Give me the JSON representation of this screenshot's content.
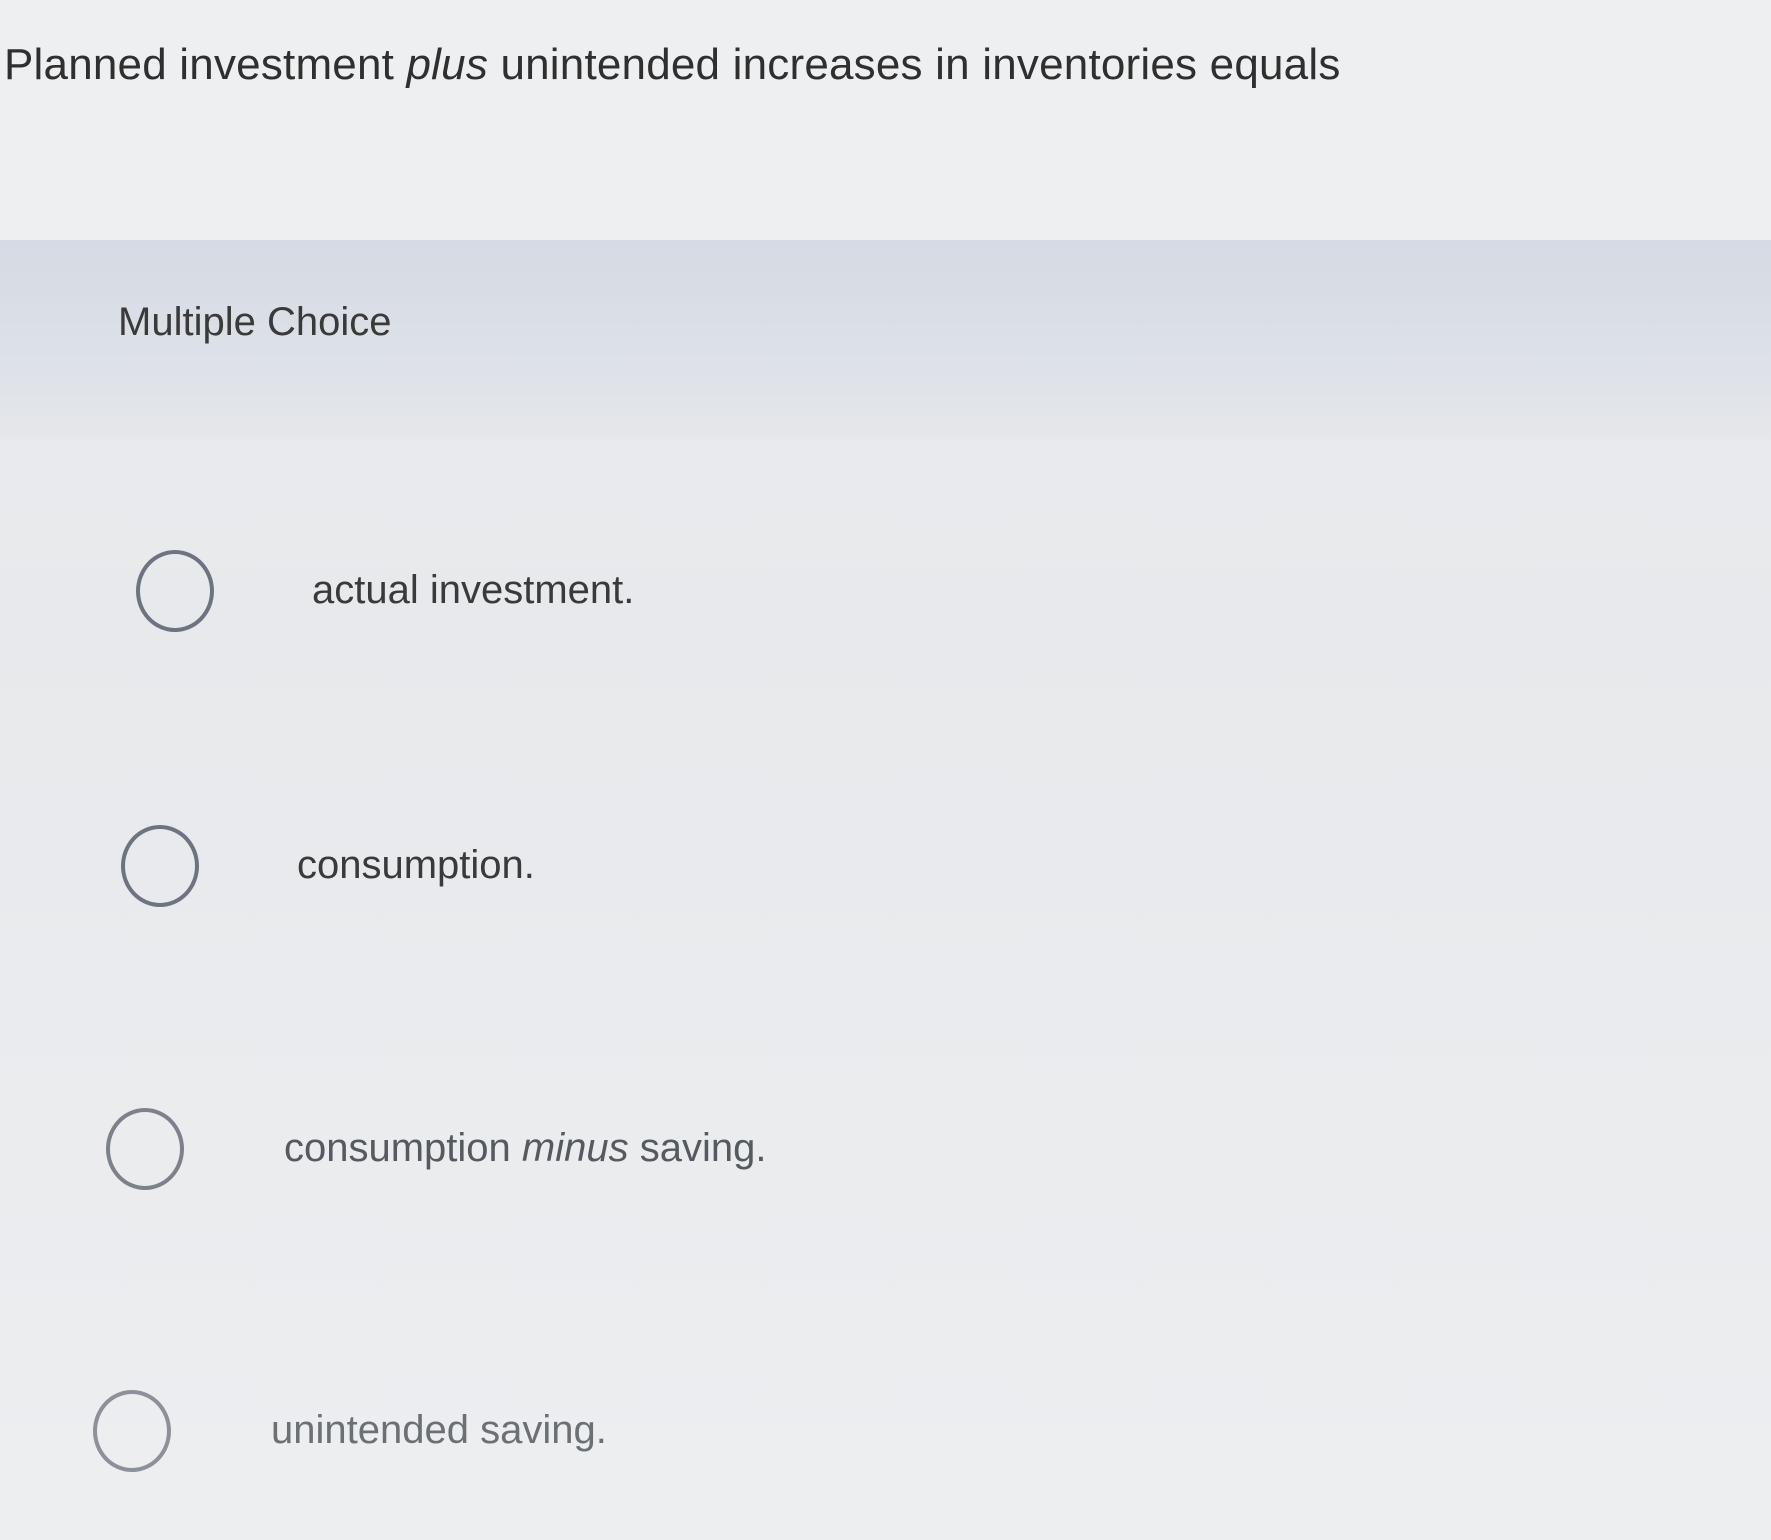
{
  "question": {
    "prefix": "Planned investment ",
    "emphasis": "plus",
    "suffix": " unintended increases in inventories equals"
  },
  "section_label": "Multiple Choice",
  "options": [
    {
      "text": "actual investment.",
      "selected": false
    },
    {
      "text": "consumption.",
      "selected": false
    },
    {
      "prefix": "consumption ",
      "emphasis": "minus",
      "suffix": " saving.",
      "selected": false
    },
    {
      "text": "unintended saving.",
      "selected": false
    }
  ],
  "colors": {
    "radio_border": "#6d7380",
    "band": "#d5dae3"
  }
}
